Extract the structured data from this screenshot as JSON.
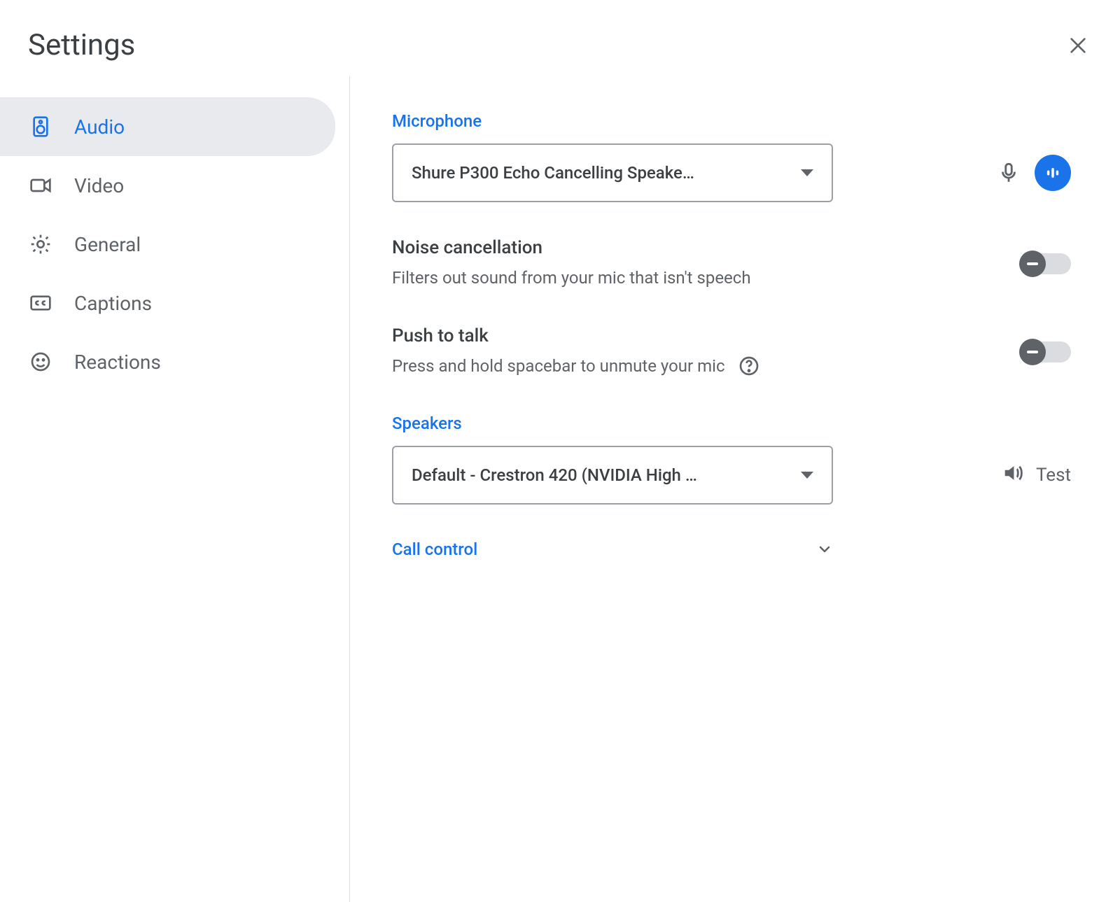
{
  "header": {
    "title": "Settings"
  },
  "sidebar": {
    "items": [
      {
        "label": "Audio"
      },
      {
        "label": "Video"
      },
      {
        "label": "General"
      },
      {
        "label": "Captions"
      },
      {
        "label": "Reactions"
      }
    ]
  },
  "audio": {
    "microphone": {
      "label": "Microphone",
      "selected": "Shure P300 Echo Cancelling Speake…"
    },
    "noise_cancellation": {
      "title": "Noise cancellation",
      "description": "Filters out sound from your mic that isn't speech",
      "enabled": false
    },
    "push_to_talk": {
      "title": "Push to talk",
      "description": "Press and hold spacebar to unmute your mic",
      "enabled": false
    },
    "speakers": {
      "label": "Speakers",
      "selected": "Default - Crestron 420 (NVIDIA High …",
      "test_label": "Test"
    },
    "call_control": {
      "label": "Call control"
    }
  }
}
